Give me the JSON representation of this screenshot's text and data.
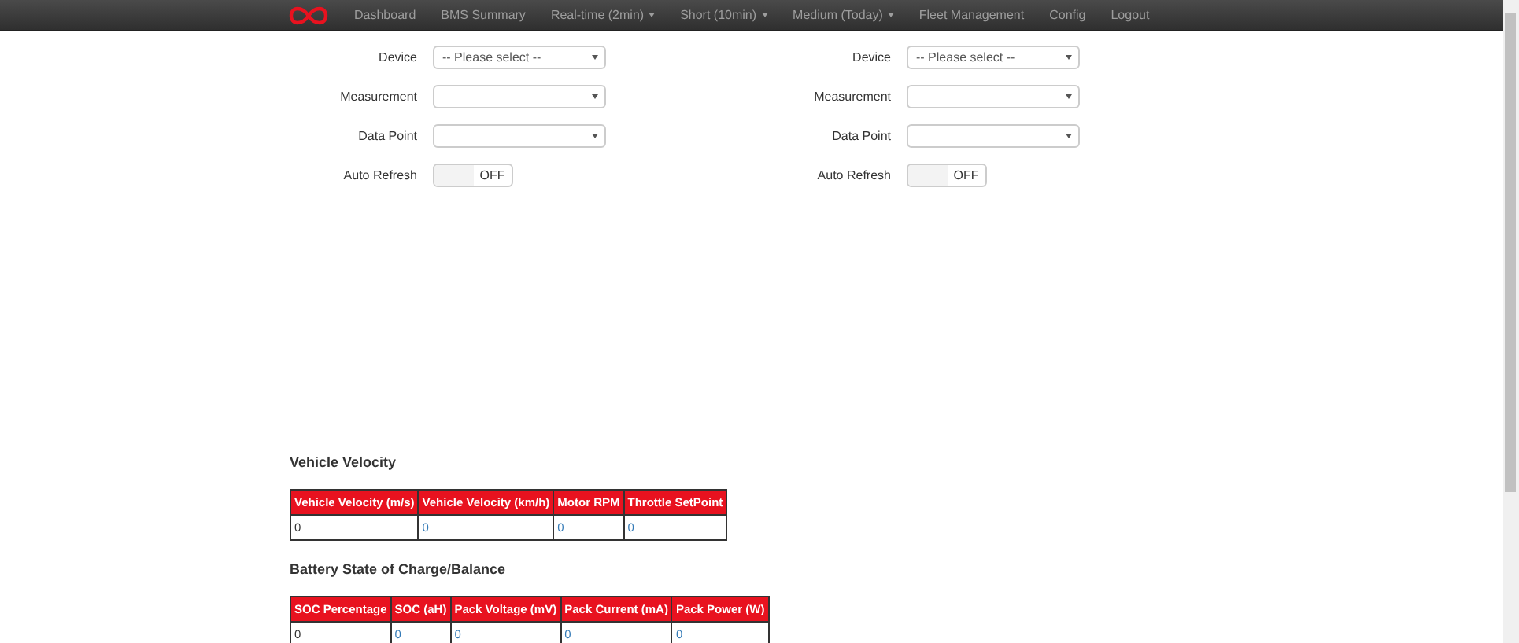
{
  "navbar": {
    "items": [
      {
        "label": "Dashboard",
        "dropdown": false
      },
      {
        "label": "BMS Summary",
        "dropdown": false
      },
      {
        "label": "Real-time (2min)",
        "dropdown": true
      },
      {
        "label": "Short (10min)",
        "dropdown": true
      },
      {
        "label": "Medium (Today)",
        "dropdown": true
      },
      {
        "label": "Fleet Management",
        "dropdown": false
      },
      {
        "label": "Config",
        "dropdown": false
      },
      {
        "label": "Logout",
        "dropdown": false
      }
    ]
  },
  "panels": [
    {
      "fields": [
        {
          "kind": "select",
          "label": "Device",
          "value": "-- Please select --"
        },
        {
          "kind": "select",
          "label": "Measurement"
        },
        {
          "kind": "select",
          "label": "Data Point"
        },
        {
          "kind": "toggle",
          "label": "Auto Refresh",
          "state_text": "OFF",
          "on": false
        }
      ]
    },
    {
      "fields": [
        {
          "kind": "select",
          "label": "Device",
          "value": "-- Please select --"
        },
        {
          "kind": "select",
          "label": "Measurement"
        },
        {
          "kind": "select",
          "label": "Data Point"
        },
        {
          "kind": "toggle",
          "label": "Auto Refresh",
          "state_text": "OFF",
          "on": false
        }
      ]
    }
  ],
  "tables": [
    {
      "title": "Vehicle Velocity",
      "columns": [
        "Vehicle Velocity (m/s)",
        "Vehicle Velocity (km/h)",
        "Motor RPM",
        "Throttle SetPoint"
      ],
      "rows": [
        [
          "0",
          "0",
          "0",
          "0"
        ]
      ]
    },
    {
      "title": "Battery State of Charge/Balance",
      "columns": [
        "SOC Percentage",
        "SOC (aH)",
        "Pack Voltage (mV)",
        "Pack Current (mA)",
        "Pack Power (W)"
      ],
      "rows": [
        [
          "0",
          "0",
          "0",
          "0",
          "0"
        ]
      ]
    }
  ]
}
